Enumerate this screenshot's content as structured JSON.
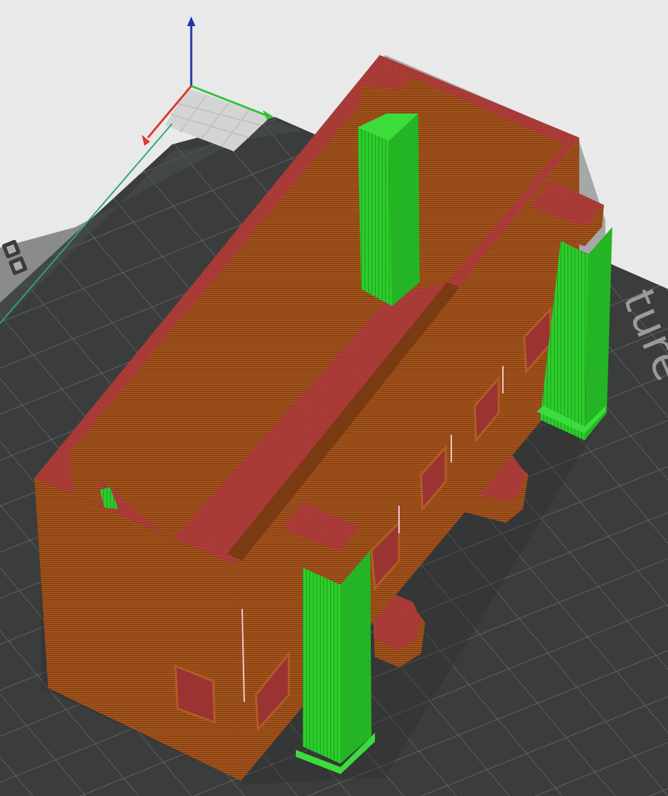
{
  "viewport": {
    "background": "#e9e9ea",
    "bed_color": "#3b3d3d",
    "grid_color": "#6f7172",
    "origin_patch_color": "#d4d4d4"
  },
  "bed_label": {
    "text": "ture"
  },
  "axes": {
    "x_color": "#d93a2b",
    "y_color": "#34c23a",
    "z_color": "#1e33a6"
  },
  "model": {
    "wall_color": "#8b4314",
    "wall_color_light": "#a5521a",
    "top_color": "#9b3333",
    "floor_color": "#a33838",
    "support_color": "#2ccc2c",
    "support_dark": "#1a9e1a"
  },
  "logo": {
    "icons": [
      "bed-logo-icon",
      "bed-logo-icon"
    ]
  }
}
